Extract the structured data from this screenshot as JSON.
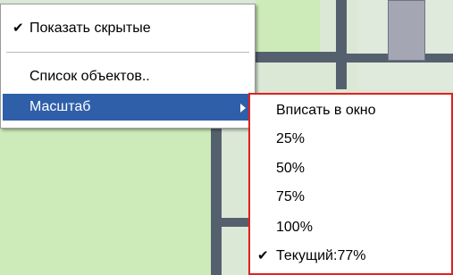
{
  "context_menu": {
    "items": [
      {
        "label": "Показать скрытые",
        "checked": true,
        "check_icon": "✔"
      },
      {
        "label": "Список объектов.."
      },
      {
        "label": "Масштаб",
        "has_submenu": true
      }
    ]
  },
  "zoom_submenu": {
    "items": [
      {
        "label": "Вписать в окно"
      },
      {
        "label": "25%"
      },
      {
        "label": "50%"
      },
      {
        "label": "75%"
      },
      {
        "label": "100%"
      },
      {
        "label": "Текущий:77%",
        "checked": true,
        "check_icon": "✔"
      }
    ]
  },
  "colors": {
    "selection": "#2f5fa9",
    "submenu_highlight_border": "#e02020",
    "room_fill": "#ccebb8",
    "wall": "#55606e"
  }
}
